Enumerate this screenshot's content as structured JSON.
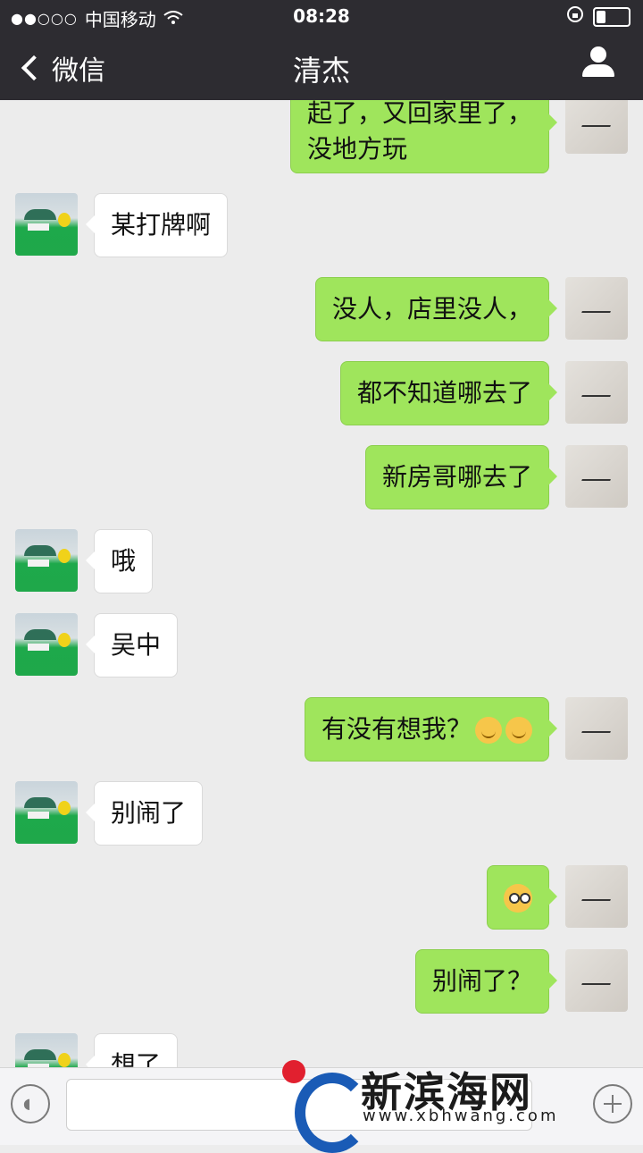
{
  "status_bar": {
    "signal": "●●○○○",
    "carrier": "中国移动",
    "time": "08:28"
  },
  "nav": {
    "back_label": "微信",
    "title": "清杰"
  },
  "messages": [
    {
      "side": "right",
      "text": "起了，又回家里了，",
      "text2": "没地方玩"
    },
    {
      "side": "left",
      "text": "某打牌啊"
    },
    {
      "side": "right",
      "text": "没人，店里没人，"
    },
    {
      "side": "right",
      "text": "都不知道哪去了"
    },
    {
      "side": "right",
      "text": "新房哥哪去了"
    },
    {
      "side": "left",
      "text": "哦"
    },
    {
      "side": "left",
      "text": "吴中"
    },
    {
      "side": "right",
      "text": "有没有想我？",
      "emoji": "smile-emoji"
    },
    {
      "side": "left",
      "text": "别闹了"
    },
    {
      "side": "right",
      "text": "",
      "sticker": "confused-emoji"
    },
    {
      "side": "right",
      "text": "别闹了？"
    },
    {
      "side": "left",
      "text": "想了"
    }
  ],
  "watermark": {
    "text": "新滨海网",
    "url": "www.xbhwang.com",
    "colors": {
      "dot": "#e1202f",
      "arc": "#1a5bb6"
    }
  },
  "colors": {
    "nav_bg": "#2d2c31",
    "chat_bg": "#ececec",
    "sent_bubble": "#9fe55c",
    "received_bubble": "#ffffff"
  }
}
